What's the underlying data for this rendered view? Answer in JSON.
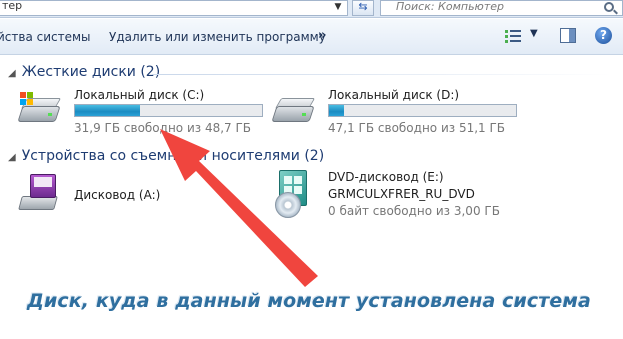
{
  "address_bar": {
    "path_fragment": "тер",
    "search_placeholder": "Поиск: Компьютер"
  },
  "toolbar": {
    "system_properties_label": "йства системы",
    "uninstall_label": "Удалить или изменить программу",
    "more_label": "»"
  },
  "groups": {
    "hard_drives": {
      "title": "Жесткие диски (2)",
      "drives": [
        {
          "name": "Локальный диск (C:)",
          "free_text": "31,9 ГБ свободно из 48,7 ГБ",
          "used_fraction": 0.345
        },
        {
          "name": "Локальный диск (D:)",
          "free_text": "47,1 ГБ свободно из 51,1 ГБ",
          "used_fraction": 0.078
        }
      ]
    },
    "removable": {
      "title": "Устройства со съемными носителями (2)",
      "devices": [
        {
          "name": "Дисковод (A:)"
        },
        {
          "name": "DVD-дисковод (E:)",
          "label": "GRMCULXFRER_RU_DVD",
          "free_text": "0 байт свободно из 3,00 ГБ"
        }
      ]
    }
  },
  "annotation": {
    "caption": "Диск, куда в данный момент установлена система",
    "arrow_color": "#f0453e"
  }
}
